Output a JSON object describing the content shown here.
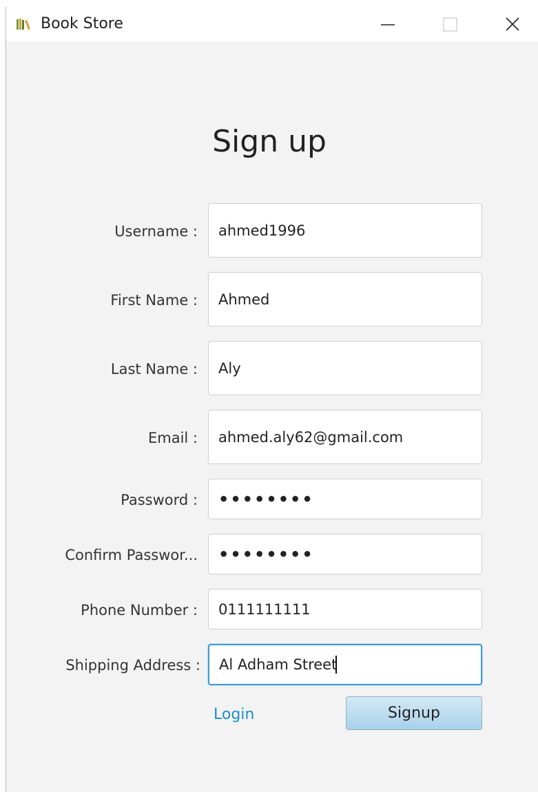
{
  "window": {
    "title": "Book Store",
    "icon": "books-icon",
    "controls": [
      "minimize-icon",
      "maximize-icon",
      "close-icon"
    ]
  },
  "form": {
    "heading": "Sign up",
    "fields": [
      {
        "label": "Username :",
        "value": "ahmed1996",
        "type": "text"
      },
      {
        "label": "First Name :",
        "value": "Ahmed",
        "type": "text"
      },
      {
        "label": "Last Name :",
        "value": "Aly",
        "type": "text"
      },
      {
        "label": "Email :",
        "value": "ahmed.aly62@gmail.com",
        "type": "text"
      },
      {
        "label": "Password :",
        "value": "••••••••",
        "type": "password"
      },
      {
        "label": "Confirm Passwor...",
        "value": "••••••••",
        "type": "password"
      },
      {
        "label": "Phone Number :",
        "value": "0111111111",
        "type": "text"
      },
      {
        "label": "Shipping Address :",
        "value": "Al Adham Street",
        "type": "text",
        "focused": true
      }
    ],
    "login_label": "Login",
    "signup_label": "Signup"
  },
  "colors": {
    "background": "#f3f3f3",
    "link": "#1f8ecb",
    "focus_border": "#3d9bd0",
    "button": "#a9d1ea"
  }
}
